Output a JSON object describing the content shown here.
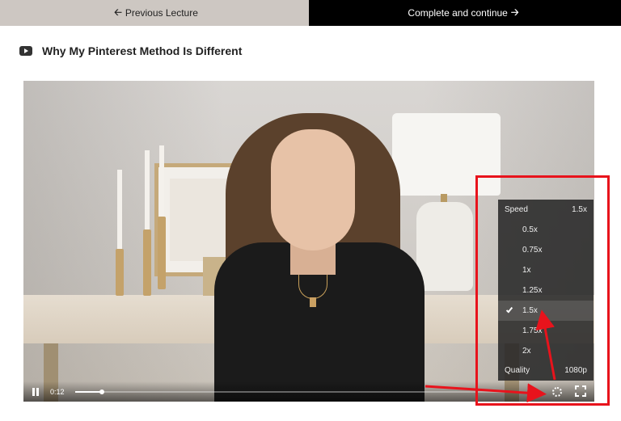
{
  "nav": {
    "prev_label": "Previous Lecture",
    "next_label": "Complete and continue"
  },
  "lecture": {
    "title": "Why My Pinterest Method Is Different"
  },
  "player": {
    "current_time": "0:12",
    "progress_fraction": 0.06
  },
  "settings_menu": {
    "speed_label": "Speed",
    "speed_value": "1.5x",
    "speed_options": [
      "0.5x",
      "0.75x",
      "1x",
      "1.25x",
      "1.5x",
      "1.75x",
      "2x"
    ],
    "selected_option": "1.5x",
    "quality_label": "Quality",
    "quality_value": "1080p"
  },
  "annotation": {
    "color": "#e8131c"
  },
  "colors": {
    "prev_button_bg": "#cdc7c2",
    "next_button_bg": "#000000"
  }
}
